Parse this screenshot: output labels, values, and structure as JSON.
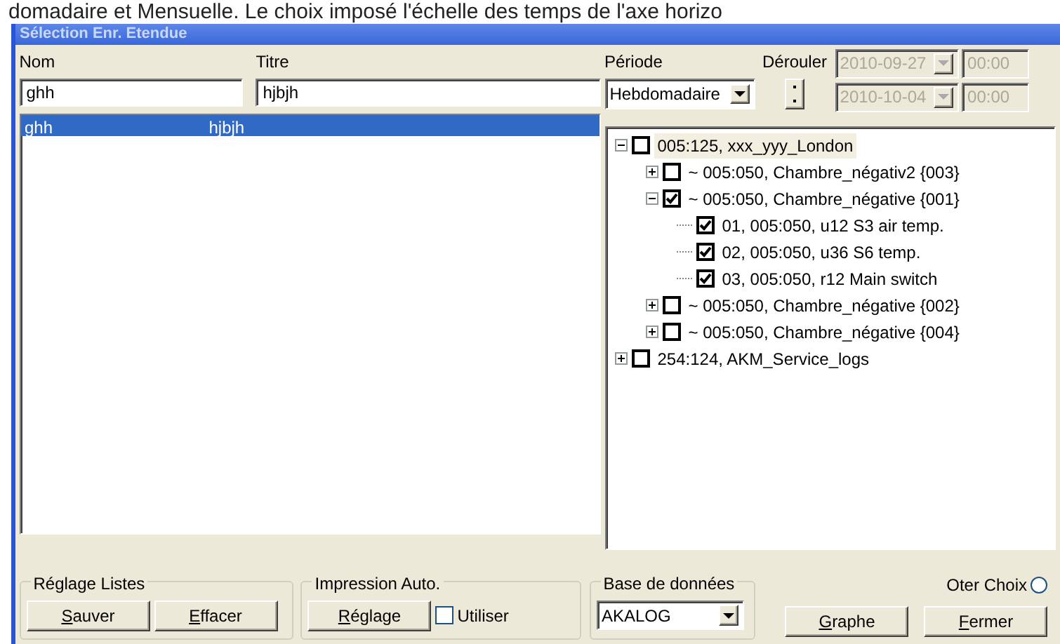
{
  "background_text": "domadaire et Mensuelle. Le choix imposé l'échelle des temps de l'axe horizo",
  "window": {
    "title": "Sélection Enr. Etendue"
  },
  "fields": {
    "nom_label": "Nom",
    "nom_value": "ghh",
    "titre_label": "Titre",
    "titre_value": "hjbjh"
  },
  "periode": {
    "label": "Période",
    "value": "Hebdomadaire",
    "scroll_label": "Dérouler"
  },
  "dates": [
    {
      "date": "2010-09-27",
      "time": "00:00",
      "disabled": true
    },
    {
      "date": "2010-10-04",
      "time": "00:00",
      "disabled": true
    }
  ],
  "list_rows": [
    {
      "nom": "ghh",
      "titre": "hjbjh",
      "selected": true
    }
  ],
  "tree": [
    {
      "label": "005:125, xxx_yyy_London",
      "checked": false,
      "expanded": true,
      "selected": true,
      "children": [
        {
          "label": "~ 005:050, Chambre_négativ2  {003}",
          "checked": false,
          "expanded": false,
          "selected": false
        },
        {
          "label": "~ 005:050, Chambre_négative  {001}",
          "checked": true,
          "expanded": true,
          "selected": false,
          "children": [
            {
              "label": "01, 005:050, u12 S3 air temp.",
              "checked": true,
              "selected": false
            },
            {
              "label": "02, 005:050, u36 S6 temp.",
              "checked": true,
              "selected": false
            },
            {
              "label": "03, 005:050, r12 Main switch",
              "checked": true,
              "selected": false
            }
          ]
        },
        {
          "label": "~ 005:050, Chambre_négative  {002}",
          "checked": false,
          "expanded": false,
          "selected": false
        },
        {
          "label": "~ 005:050, Chambre_négative  {004}",
          "checked": false,
          "expanded": false,
          "selected": false
        }
      ]
    },
    {
      "label": "254:124, AKM_Service_logs",
      "checked": false,
      "expanded": false,
      "selected": false
    }
  ],
  "groups": [
    {
      "title": "Réglage Listes",
      "items": [
        {
          "kind": "button",
          "label": "Sauver",
          "mnemonic": true
        },
        {
          "kind": "button",
          "label": "Effacer",
          "mnemonic": true
        }
      ]
    },
    {
      "title": "Impression Auto.",
      "items": [
        {
          "kind": "button",
          "label": "Réglage",
          "mnemonic": true
        },
        {
          "kind": "checkbox",
          "label": "Utiliser",
          "checked": false
        }
      ]
    },
    {
      "title": "Base de données",
      "items": [
        {
          "kind": "dropdown",
          "label": "AKALOG"
        }
      ]
    }
  ],
  "actions": [
    {
      "label": "Graphe",
      "mnemonic": true
    },
    {
      "label": "Fermer",
      "mnemonic": true
    }
  ],
  "oter_choix": {
    "label": "Oter Choix",
    "selected": false
  }
}
